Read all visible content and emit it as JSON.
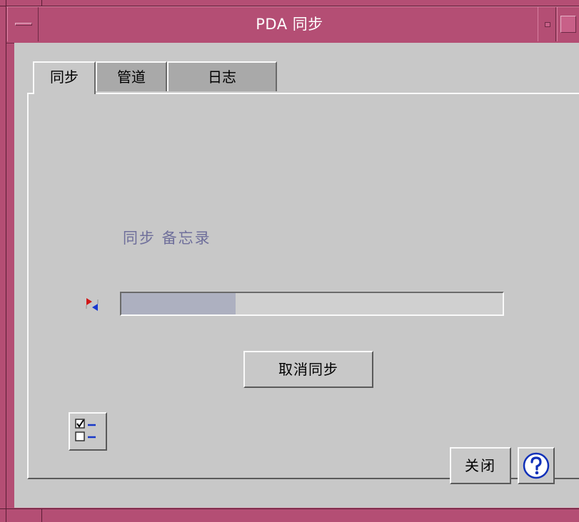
{
  "window": {
    "title": "PDA 同步"
  },
  "tabs": [
    {
      "label": "同步",
      "active": true
    },
    {
      "label": "管道",
      "active": false
    },
    {
      "label": "日志",
      "active": false
    }
  ],
  "sync": {
    "status_text": "同步 备忘录",
    "progress_fraction": 0.3,
    "cancel_label": "取消同步"
  },
  "footer": {
    "close_label": "关闭"
  },
  "icons": {
    "system_menu": "window-menu-icon",
    "minimize": "minimize-icon",
    "maximize": "maximize-icon",
    "sync": "sync-arrows-icon",
    "checklist": "checklist-icon",
    "help": "help-icon"
  },
  "colors": {
    "title_bar": "#b44e74",
    "window_bg": "#c8c8c8",
    "status_text": "#6f6f9b",
    "progress_fill": "#adb0c0"
  }
}
